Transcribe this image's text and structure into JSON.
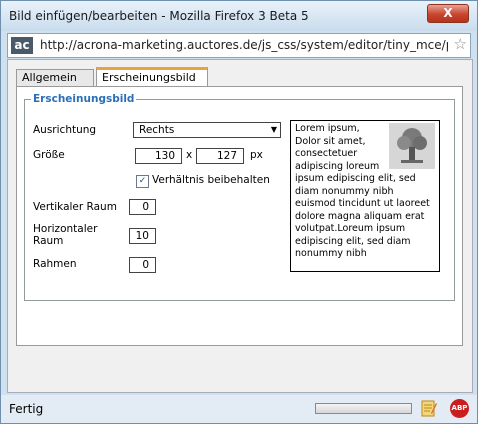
{
  "window": {
    "title": "Bild einfügen/bearbeiten - Mozilla Firefox 3 Beta 5",
    "close_label": "X"
  },
  "addressbar": {
    "site_icon_text": "ac",
    "url": "http://acrona-marketing.auctores.de/js_css/system/editor/tiny_mce/plugins",
    "bookmark_icon": "star-icon"
  },
  "tabs": [
    {
      "label": "Allgemein",
      "active": false
    },
    {
      "label": "Erscheinungsbild",
      "active": true
    }
  ],
  "group": {
    "title": "Erscheinungsbild"
  },
  "form": {
    "alignment_label": "Ausrichtung",
    "alignment_value": "Rechts",
    "size_label": "Größe",
    "width": "130",
    "size_sep": "x",
    "height": "127",
    "size_unit": "px",
    "keep_ratio_label": "Verhältnis beibehalten",
    "keep_ratio_checked": true,
    "vspace_label": "Vertikaler Raum",
    "vspace": "0",
    "hspace_label": "Horizontaler Raum",
    "hspace": "10",
    "border_label": "Rahmen",
    "border": "0"
  },
  "preview": {
    "text": "Lorem ipsum, Dolor sit amet, consectetuer adipiscing loreum ipsum edipiscing elit, sed diam nonummy nibh euismod tincidunt ut laoreet dolore magna aliquam erat volutpat.Loreum ipsum edipiscing elit, sed diam nonummy nibh"
  },
  "statusbar": {
    "text": "Fertig",
    "progress": 0,
    "abp_label": "ABP"
  },
  "colors": {
    "accent_tab": "#e8a33c",
    "legend": "#2b6fb6",
    "abp": "#c81e1e"
  }
}
